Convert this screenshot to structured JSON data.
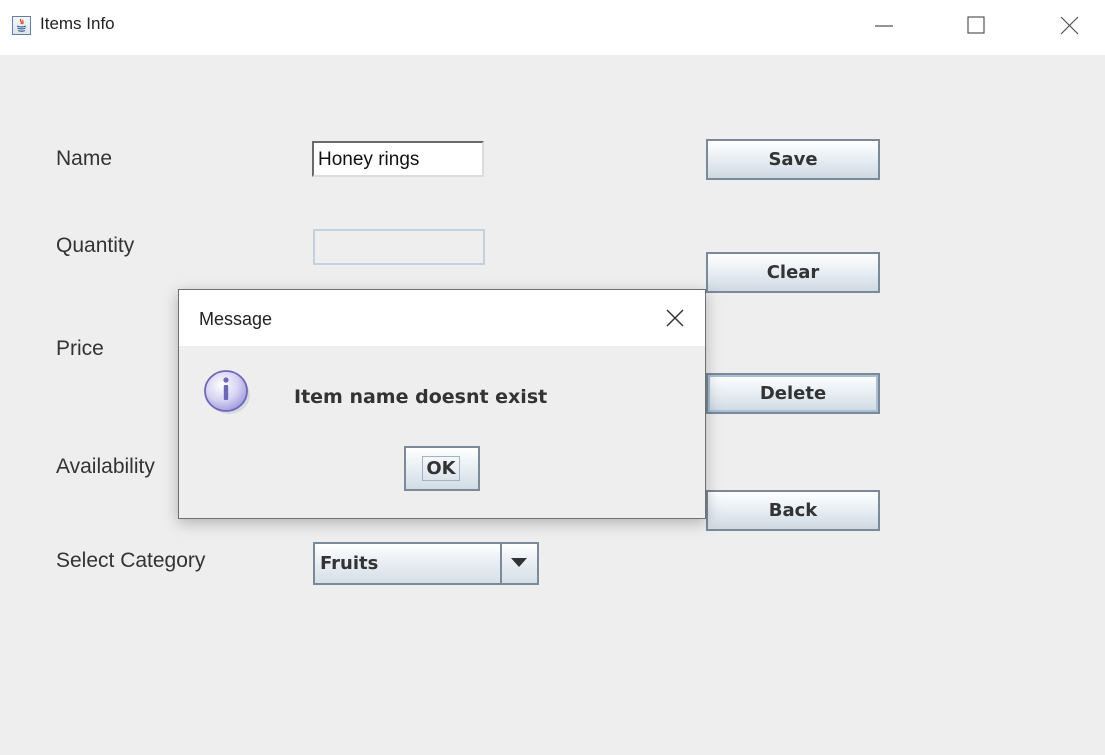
{
  "window": {
    "title": "Items Info",
    "icon": "java-app-icon"
  },
  "form": {
    "name_label": "Name",
    "name_value": "Honey rings",
    "quantity_label": "Quantity",
    "quantity_value": "",
    "price_label": "Price",
    "availability_label": "Availability",
    "category_label": "Select Category",
    "category_selected": "Fruits"
  },
  "actions": {
    "save_label": "Save",
    "clear_label": "Clear",
    "delete_label": "Delete",
    "back_label": "Back"
  },
  "dialog": {
    "title": "Message",
    "message": "Item name doesnt exist",
    "ok_label": "OK",
    "icon": "info-icon"
  }
}
